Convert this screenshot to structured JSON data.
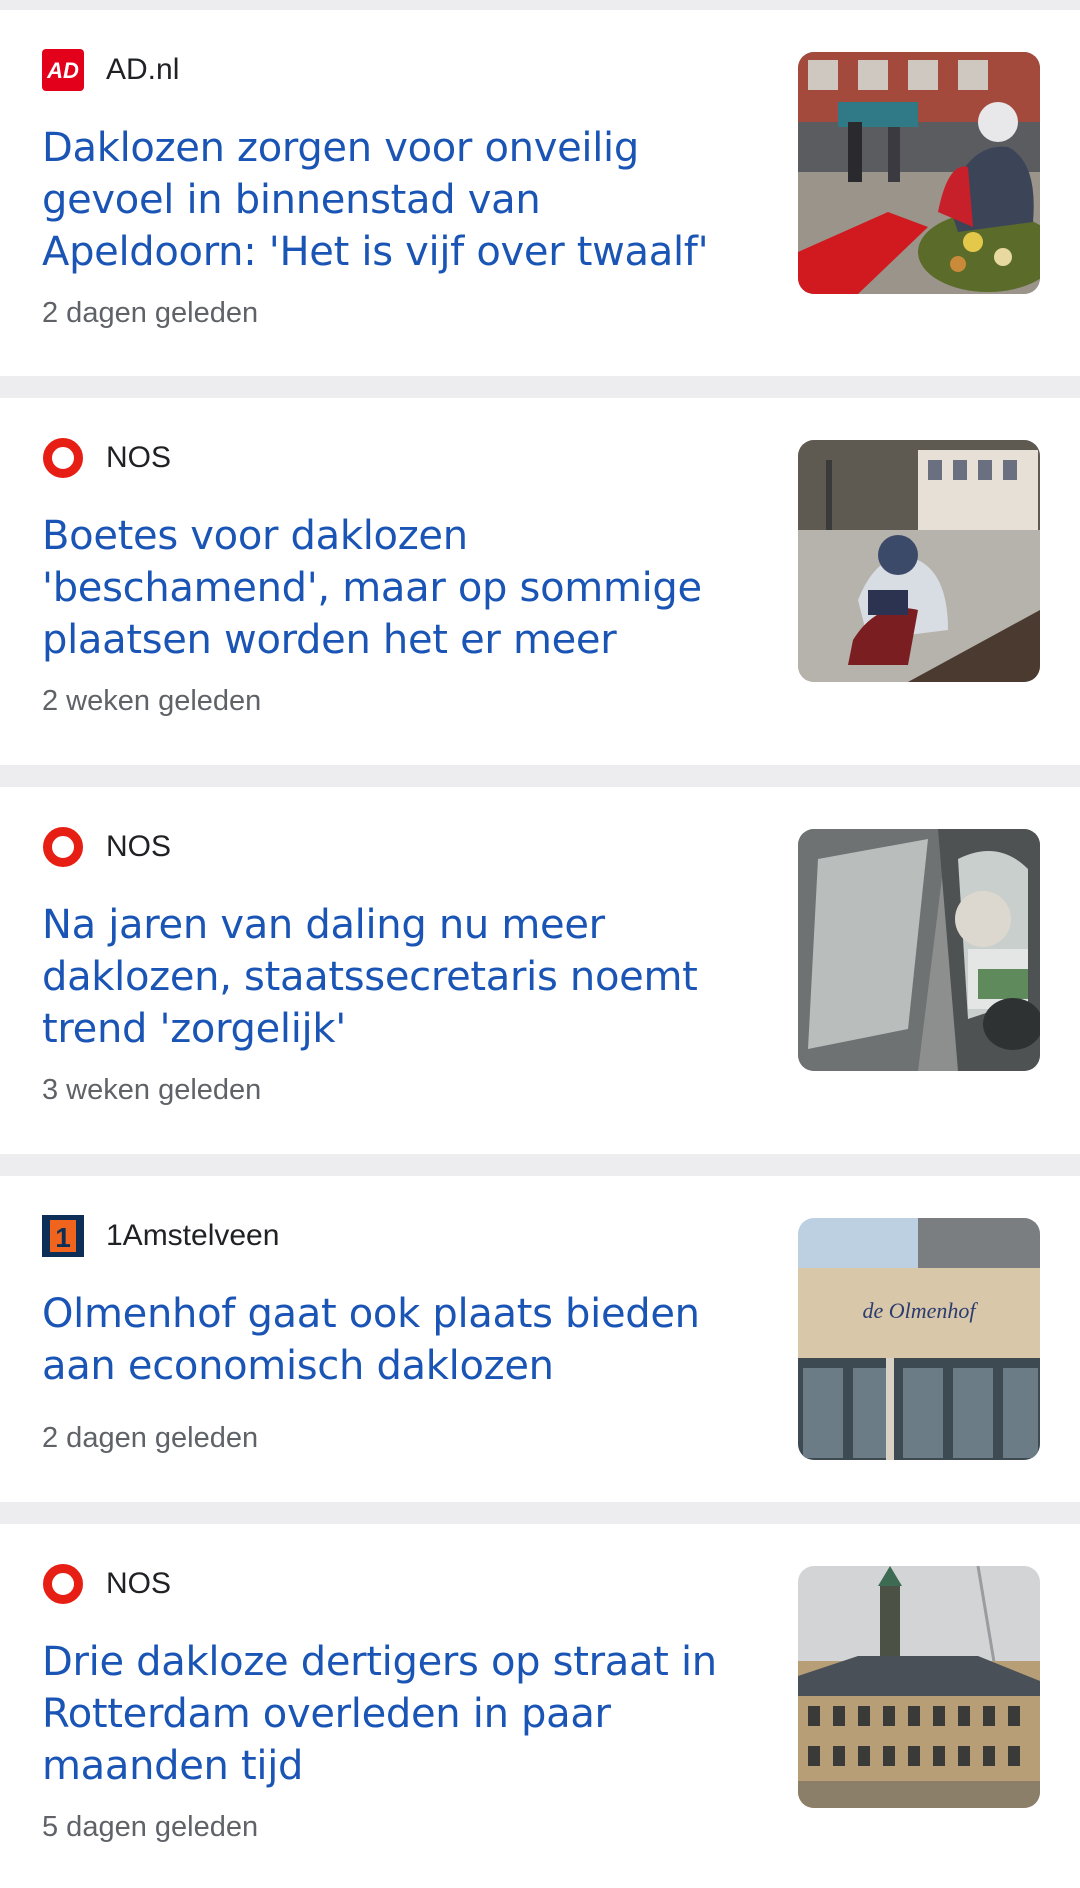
{
  "articles": [
    {
      "source": "AD.nl",
      "logo": "ad-logo",
      "logo_text": "AD",
      "headline": "Daklozen zorgen voor onveilig gevoel in binnenstad van Apeldoorn: 'Het is vijf over twaalf'",
      "timestamp": "2 dagen geleden",
      "thumbnail": "street-scene-with-person-sitting-image"
    },
    {
      "source": "NOS",
      "logo": "nos-logo",
      "headline": "Boetes voor daklozen 'beschamend', maar op sommige plaatsen worden het er meer",
      "timestamp": "2 weken geleden",
      "thumbnail": "person-on-bench-in-square-image"
    },
    {
      "source": "NOS",
      "logo": "nos-logo",
      "headline": "Na jaren van daling nu meer daklozen, staatssecretaris noemt trend 'zorgelijk'",
      "timestamp": "3 weken geleden",
      "thumbnail": "person-in-car-image"
    },
    {
      "source": "1Amstelveen",
      "logo": "1amstelveen-logo",
      "logo_text": "1",
      "headline": "Olmenhof gaat ook plaats bieden aan economisch daklozen",
      "timestamp": "2 dagen geleden",
      "thumbnail": "olmenhof-building-image",
      "thumbnail_sign": "de Olmenhof"
    },
    {
      "source": "NOS",
      "logo": "nos-logo",
      "headline": "Drie dakloze dertigers op straat in Rotterdam overleden in paar maanden tijd",
      "timestamp": "5 dagen geleden",
      "thumbnail": "rotterdam-city-hall-image"
    }
  ],
  "colors": {
    "headline": "#1a55b6",
    "timestamp": "#5f6368",
    "source": "#202124",
    "separator": "#ededf0",
    "ad_red": "#e3001b",
    "nos_red": "#e61e14",
    "amstelveen_navy": "#0d2f57",
    "amstelveen_orange": "#f0641e"
  }
}
